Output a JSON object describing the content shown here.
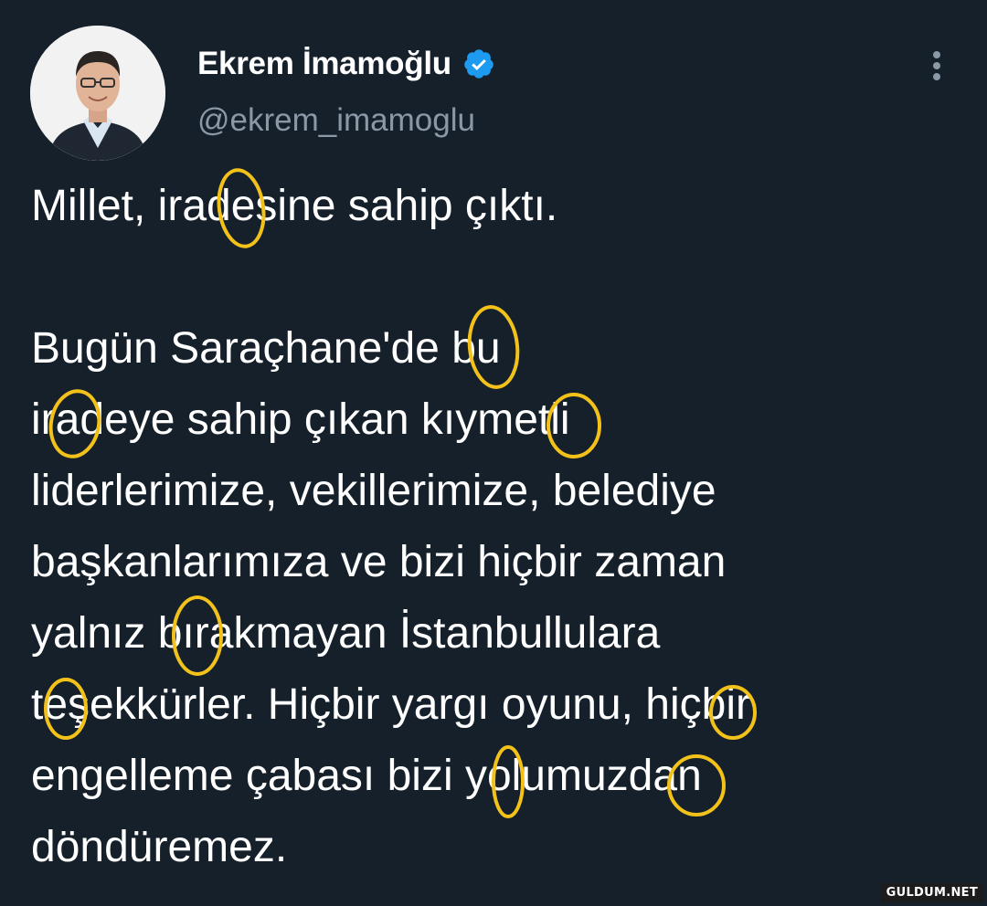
{
  "author": {
    "display_name": "Ekrem İmamoğlu",
    "handle": "@ekrem_imamoglu",
    "verified": true,
    "avatar_icon": "profile-photo",
    "verified_icon": "verified-badge-icon",
    "more_icon": "more-vertical-icon"
  },
  "tweet": {
    "paragraph_1": "Millet, iradesine sahip çıktı.",
    "lines": [
      "Bugün Saraçhane'de bu",
      "iradeye sahip çıkan kıymetli",
      "liderlerimize, vekillerimize, belediye",
      "başkanlarımıza ve bizi hiçbir zaman",
      "yalnız bırakmayan İstanbullulara",
      "teşekkürler. Hiçbir yargı oyunu, hiçbir",
      "engelleme çabası bizi yolumuzdan",
      "döndüremez."
    ]
  },
  "watermark": "GULDUM.NET",
  "colors": {
    "background": "#15202b",
    "text": "#ffffff",
    "secondary_text": "#8b98a5",
    "verified_blue": "#1d9bf0",
    "annotation_yellow": "#f3c21a"
  }
}
